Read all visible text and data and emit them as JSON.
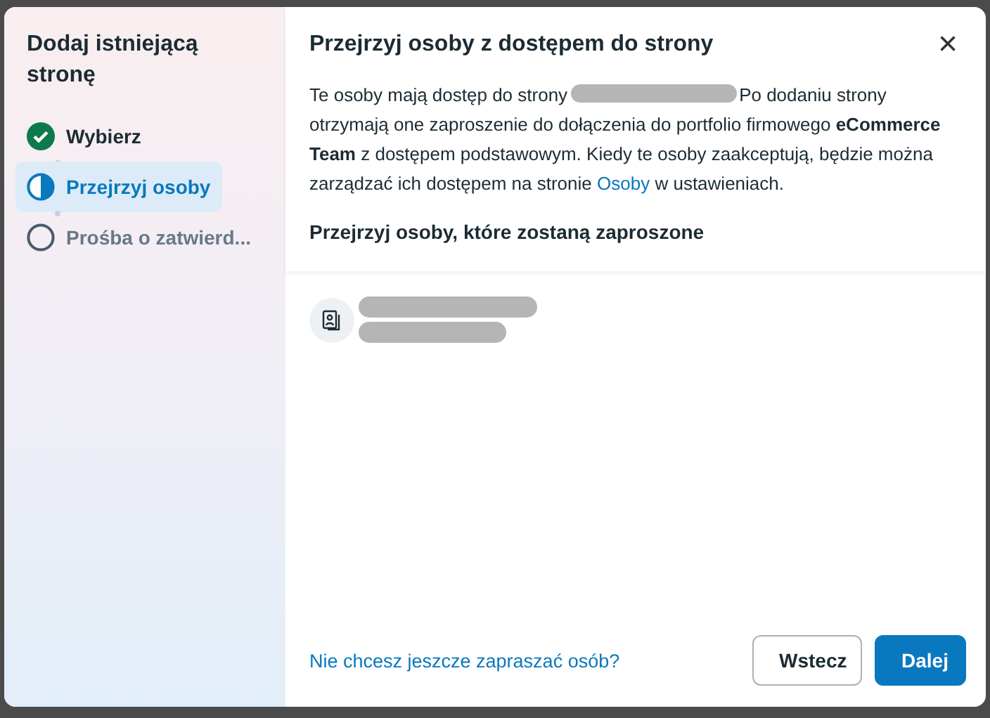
{
  "sidebar": {
    "title": "Dodaj istniejącą stronę",
    "steps": [
      {
        "label": "Wybierz",
        "kind": "done",
        "selected": false
      },
      {
        "label": "Przejrzyj osoby",
        "kind": "current",
        "selected": true
      },
      {
        "label": "Prośba o zatwierd...",
        "kind": "todo",
        "selected": false
      }
    ]
  },
  "dialog": {
    "title": "Przejrzyj osoby z dostępem do strony",
    "close": "×",
    "text_before_redaction": "Te osoby mają dostęp do strony",
    "text_after_redaction": "Po dodaniu strony otrzymają one zaproszenie do dołączenia do portfolio firmowego **eCommerce Team** z dostępem podstawowym. Kiedy te osoby zaakceptują, będzie można zarządzać ich dostępem na stronie",
    "link": "Osoby",
    "text_end": "w ustawieniach.",
    "subheading": "Przejrzyj osoby, które zostaną zaproszone",
    "people": [
      {
        "kind": "redacted"
      }
    ],
    "footer_link": "Nie chcesz jeszcze zapraszać osób?",
    "buttons": [
      {
        "label": "Wstecz",
        "kind": "secondary"
      },
      {
        "label": "Dalej",
        "kind": "primary"
      }
    ]
  }
}
